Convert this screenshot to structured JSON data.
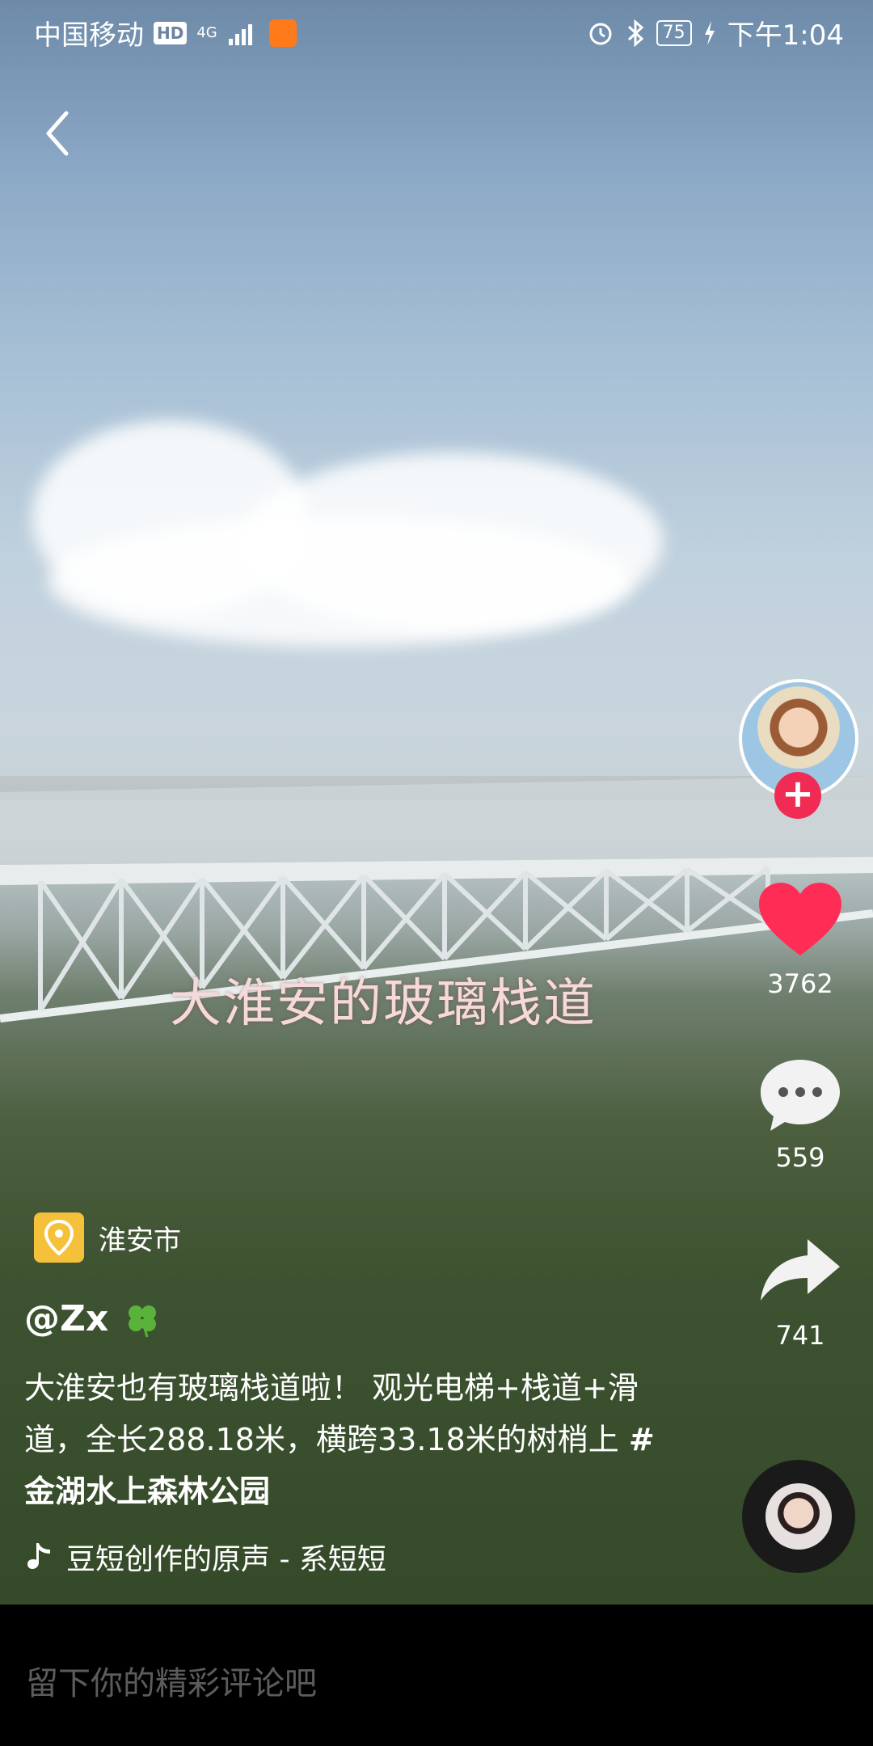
{
  "status_bar": {
    "carrier": "中国移动",
    "hd": "HD",
    "network": "4G",
    "battery": "75",
    "time": "下午1:04",
    "icons": [
      "signal-icon",
      "alarm-icon",
      "bluetooth-icon",
      "battery-icon",
      "charging-icon"
    ]
  },
  "video": {
    "overlay_caption": "大淮安的玻璃栈道"
  },
  "actions": {
    "likes": "3762",
    "comments": "559",
    "shares": "741",
    "like_color": "#ff2d55",
    "follow_color": "#f02c55"
  },
  "post": {
    "location": "淮安市",
    "username": "@Zx",
    "description": "大淮安也有玻璃栈道啦！ 观光电梯+栈道+滑道，全长288.18米，横跨33.18米的树梢上 ",
    "hashtag": "#金湖水上森林公园",
    "music": "豆短创作的原声 - 系短短"
  },
  "comment_bar": {
    "placeholder": "留下你的精彩评论吧"
  }
}
